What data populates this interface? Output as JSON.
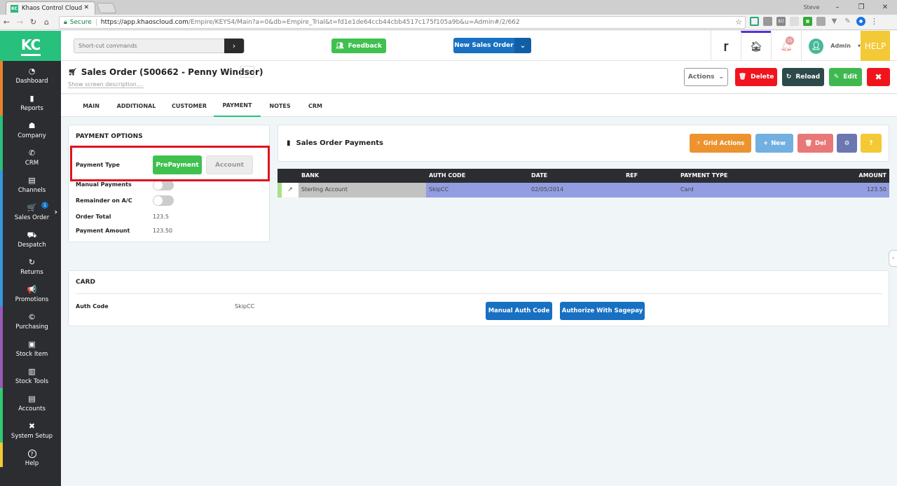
{
  "browser": {
    "tab_title": "Khaos Control Cloud",
    "favicon_text": "KC",
    "user_label": "Steve",
    "secure_label": "Secure",
    "url_host": "https://app.khaoscloud.com",
    "url_rest": "/Empire/KEYS4/Main?a=0&db=Empire_Trial&t=fd1e1de64ccb44cbb4517c175f105a9b&u=Admin#/2/662"
  },
  "topbar": {
    "logo": "KC",
    "shortcut_placeholder": "Short-cut commands",
    "feedback_label": "Feedback",
    "new_sales_order_label": "New Sales Order",
    "notification_count": "15",
    "user_name": "Admin",
    "help_label": "HELP"
  },
  "sidebar": {
    "items": [
      {
        "label": "Dashboard",
        "icon": "◔"
      },
      {
        "label": "Reports",
        "icon": "▮"
      },
      {
        "label": "Company",
        "icon": "☗"
      },
      {
        "label": "CRM",
        "icon": "✆"
      },
      {
        "label": "Channels",
        "icon": "▤"
      },
      {
        "label": "Sales Order",
        "icon": "🛒",
        "badge": "1"
      },
      {
        "label": "Despatch",
        "icon": "⛟"
      },
      {
        "label": "Returns",
        "icon": "↻"
      },
      {
        "label": "Promotions",
        "icon": "📢"
      },
      {
        "label": "Purchasing",
        "icon": "©"
      },
      {
        "label": "Stock Item",
        "icon": "▣"
      },
      {
        "label": "Stock Tools",
        "icon": "▥"
      },
      {
        "label": "Accounts",
        "icon": "▤"
      },
      {
        "label": "System Setup",
        "icon": "✖"
      },
      {
        "label": "Help",
        "icon": "?"
      }
    ],
    "strip_colors": [
      "#e8832a",
      "#27c07d",
      "#3796dd",
      "#9b59b6",
      "#2ecc71",
      "#f3c935"
    ]
  },
  "page": {
    "title": "Sales Order (S00662 - Penny Windsor)",
    "show_description": "Show screen description....",
    "actions_label": "Actions",
    "delete_label": "Delete",
    "reload_label": "Reload",
    "edit_label": "Edit"
  },
  "tabs": [
    {
      "label": "MAIN"
    },
    {
      "label": "ADDITIONAL"
    },
    {
      "label": "CUSTOMER"
    },
    {
      "label": "PAYMENT",
      "active": true
    },
    {
      "label": "NOTES"
    },
    {
      "label": "CRM"
    }
  ],
  "payment_options": {
    "title": "PAYMENT OPTIONS",
    "payment_type_label": "Payment Type",
    "prepayment_label": "PrePayment",
    "account_label": "Account",
    "selected_type": "PrePayment",
    "manual_payments_label": "Manual Payments",
    "manual_payments_on": false,
    "remainder_label": "Remainder on A/C",
    "remainder_on": false,
    "order_total_label": "Order Total",
    "order_total": "123.5",
    "payment_amount_label": "Payment Amount",
    "payment_amount": "123.50"
  },
  "sales_order_payments": {
    "title": "Sales Order Payments",
    "grid_actions_label": "Grid Actions",
    "new_label": "New",
    "del_label": "Del",
    "help_label": "?",
    "columns": [
      "BANK",
      "AUTH CODE",
      "DATE",
      "REF",
      "PAYMENT TYPE",
      "AMOUNT"
    ],
    "rows": [
      {
        "bank": "Sterling Account",
        "auth_code": "SkipCC",
        "date": "02/05/2014",
        "ref": "",
        "payment_type": "Card",
        "amount": "123.50"
      }
    ]
  },
  "card": {
    "title": "CARD",
    "auth_code_label": "Auth Code",
    "auth_code": "SkipCC",
    "manual_auth_label": "Manual Auth Code",
    "sagepay_label": "Authorize With Sagepay"
  }
}
